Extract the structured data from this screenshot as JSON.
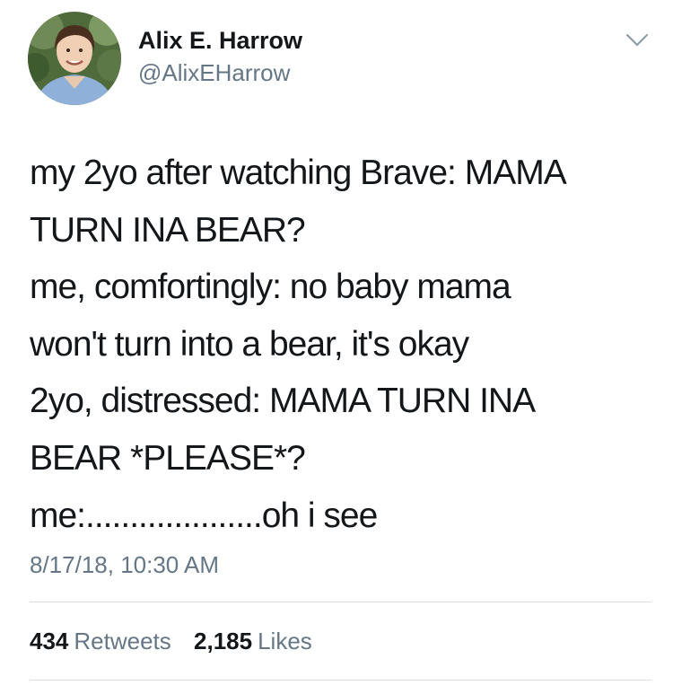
{
  "author": {
    "name": "Alix E. Harrow",
    "handle": "@AlixEHarrow",
    "avatar_icon": "user-avatar-photo"
  },
  "menu": {
    "icon": "chevron-down-icon"
  },
  "tweet": {
    "lines": [
      "my 2yo after watching Brave: MAMA",
      "TURN INA BEAR?",
      "me, comfortingly: no baby mama",
      "won't turn into a bear, it's okay",
      "2yo, distressed: MAMA TURN INA",
      "BEAR *PLEASE*?",
      "me:....................oh i see"
    ],
    "timestamp": "8/17/18, 10:30 AM"
  },
  "stats": {
    "retweets_count": "434",
    "retweets_label": "Retweets",
    "likes_count": "2,185",
    "likes_label": "Likes"
  },
  "colors": {
    "text": "#14171a",
    "secondary": "#657786",
    "divider": "#d8dde1"
  }
}
